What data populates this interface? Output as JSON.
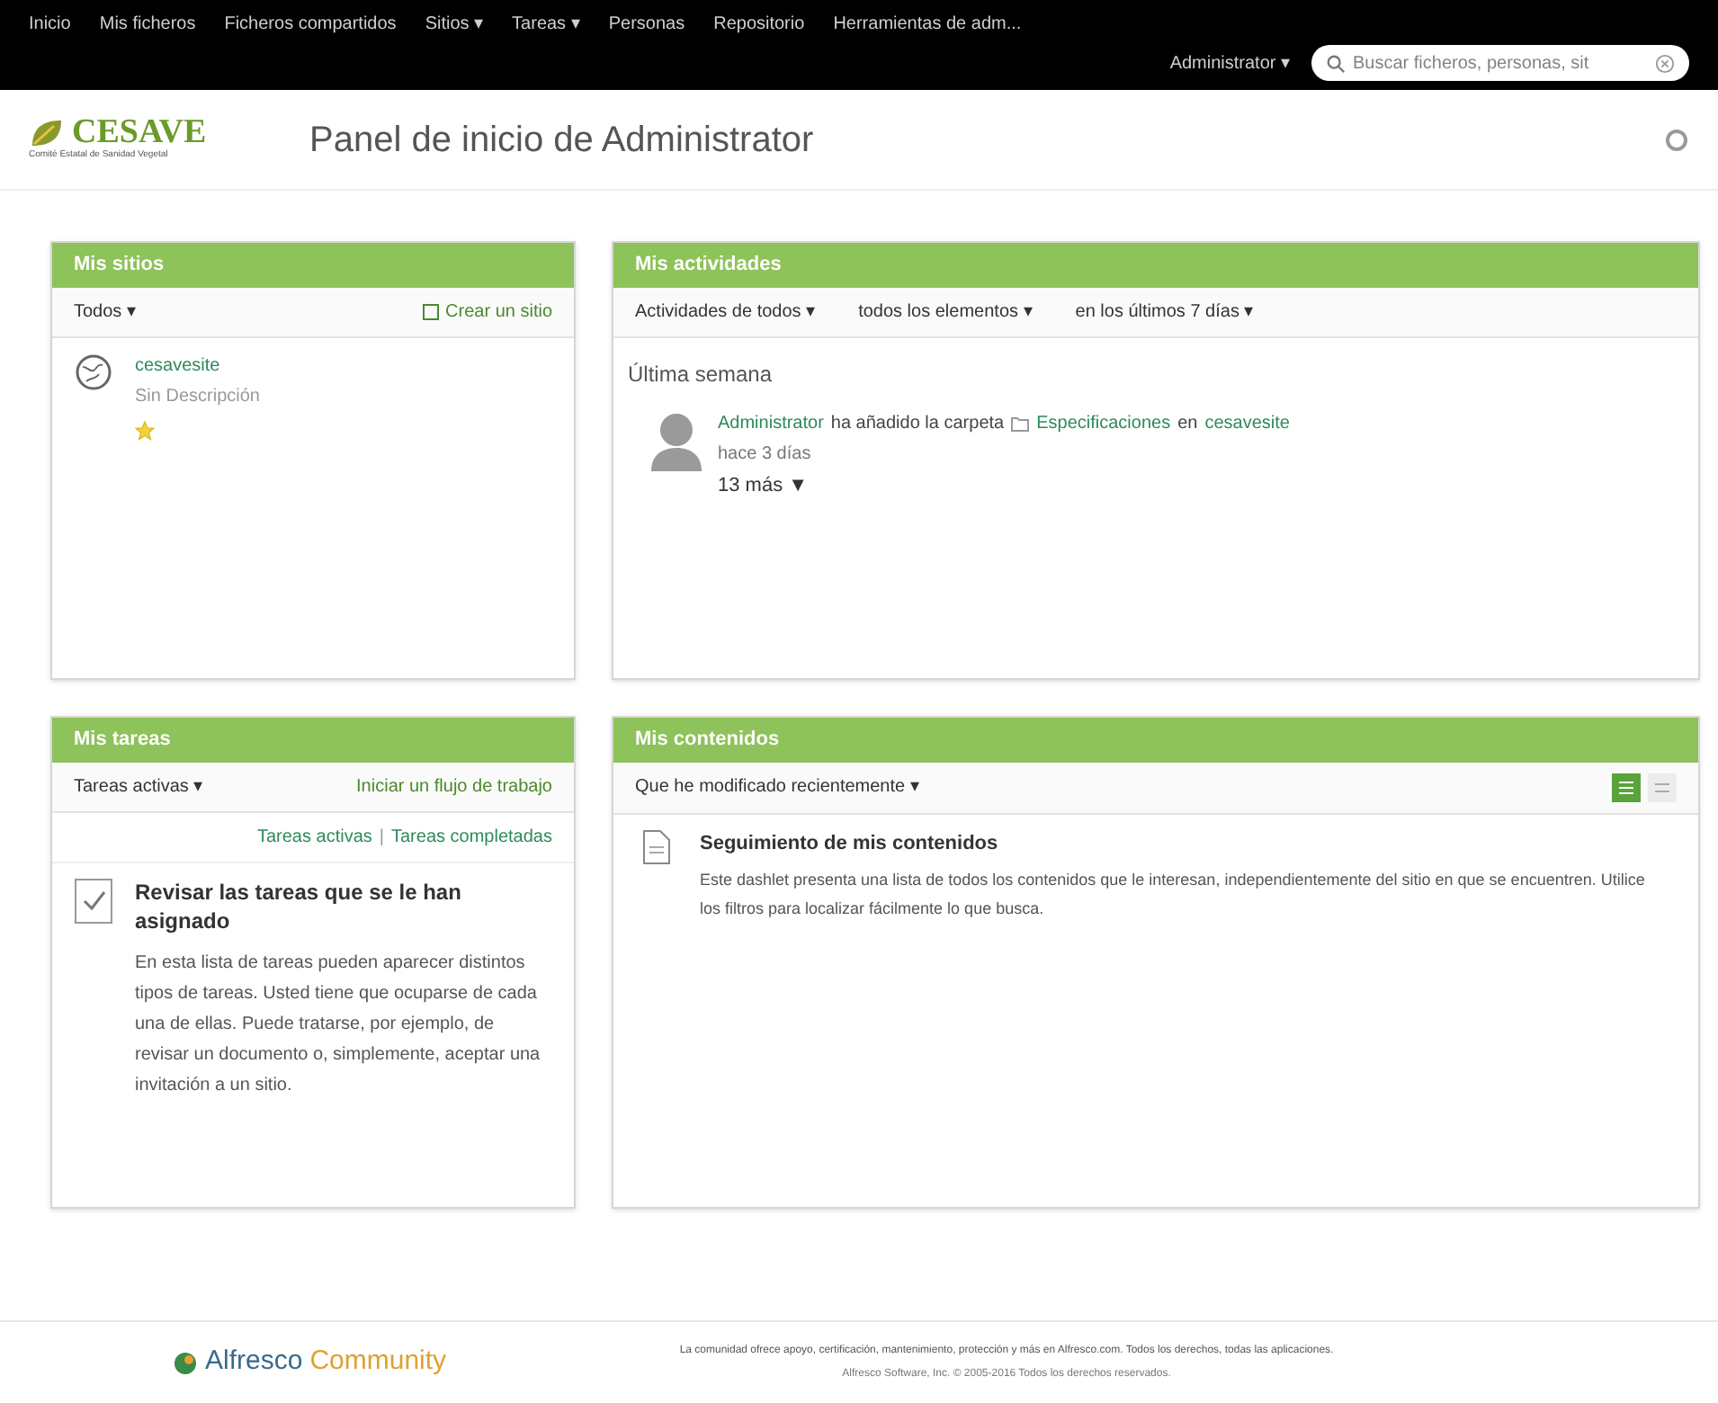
{
  "nav": {
    "items": [
      "Inicio",
      "Mis ficheros",
      "Ficheros compartidos",
      "Sitios ▾",
      "Tareas ▾",
      "Personas",
      "Repositorio",
      "Herramientas de adm..."
    ],
    "user": "Administrator ▾",
    "search": {
      "placeholder": "Buscar ficheros, personas, sit"
    }
  },
  "header": {
    "logo": "CESAVE",
    "logo_tagline": "Comité Estatal de Sanidad Vegetal",
    "title": "Panel de inicio de Administrator"
  },
  "my_sites": {
    "title": "Mis sitios",
    "filter": "Todos ▾",
    "create": "Crear un sitio",
    "sites": [
      {
        "name": "cesavesite",
        "description": "Sin Descripción",
        "favorite": true
      }
    ]
  },
  "activities": {
    "title": "Mis actividades",
    "filters": [
      "Actividades de todos ▾",
      "todos los elementos ▾",
      "en los últimos 7 días ▾"
    ],
    "group": "Última semana",
    "items": [
      {
        "user": "Administrator",
        "action": "ha añadido la carpeta",
        "target": "Especificaciones",
        "prep": "en",
        "site": "cesavesite",
        "time": "hace 3 días",
        "more": "13 más ▼"
      }
    ]
  },
  "tasks": {
    "title": "Mis tareas",
    "filter": "Tareas activas ▾",
    "start": "Iniciar un flujo de trabajo",
    "links": [
      "Tareas activas",
      "Tareas completadas"
    ],
    "separator": "|",
    "heading": "Revisar las tareas que se le han asignado",
    "body": "En esta lista de tareas pueden aparecer distintos tipos de tareas. Usted tiene que ocuparse de cada una de ellas. Puede tratarse, por ejemplo, de revisar un documento o, simplemente, aceptar una invitación a un sitio."
  },
  "content": {
    "title": "Mis contenidos",
    "filter": "Que he modificado recientemente ▾",
    "views": [
      {
        "kind": "detailed",
        "selected": true
      },
      {
        "kind": "simple",
        "selected": false
      }
    ],
    "heading": "Seguimiento de mis contenidos",
    "body": "Este dashlet presenta una lista de todos los contenidos que le interesan, independientemente del sitio en que se encuentren. Utilice los filtros para localizar fácilmente lo que busca."
  },
  "footer": {
    "brand": "Alfresco",
    "brand_suffix": "Community",
    "line1": "La comunidad ofrece apoyo, certificación, mantenimiento, protección y más en Alfresco.com. Todos los derechos, todas las aplicaciones.",
    "line2": "Alfresco Software, Inc. © 2005-2016 Todos los derechos reservados."
  }
}
